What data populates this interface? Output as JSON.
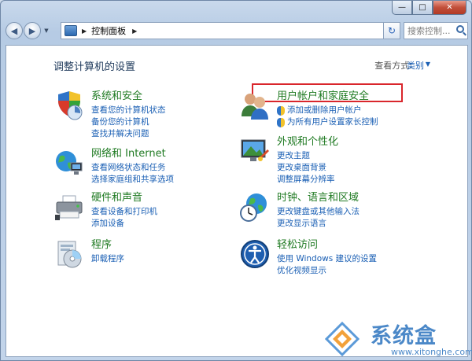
{
  "window": {
    "minimize_label": "—",
    "maximize_label": "□",
    "close_label": "✕"
  },
  "navbar": {
    "back_label": "◀",
    "forward_label": "▶",
    "history_dd": "▼",
    "breadcrumb_arrow": "▶",
    "breadcrumb": [
      "控制面板"
    ],
    "crumb_trailing_arrow": "▶",
    "address_dd": "▼",
    "refresh_label": "↻",
    "search_placeholder": "搜索控制..."
  },
  "page": {
    "title": "调整计算机的设置",
    "view_by_label": "查看方式:",
    "view_by_value": "类别",
    "view_by_dd": "▼"
  },
  "categories": [
    {
      "id": "system-security",
      "head": "系统和安全",
      "links": [
        "查看您的计算机状态",
        "备份您的计算机",
        "查找并解决问题"
      ]
    },
    {
      "id": "network-internet",
      "head": "网络和 Internet",
      "links": [
        "查看网络状态和任务",
        "选择家庭组和共享选项"
      ]
    },
    {
      "id": "hardware-sound",
      "head": "硬件和声音",
      "links": [
        "查看设备和打印机",
        "添加设备"
      ]
    },
    {
      "id": "programs",
      "head": "程序",
      "links": [
        "卸载程序"
      ]
    },
    {
      "id": "user-accounts",
      "head": "用户帐户和家庭安全",
      "links": [
        "添加或删除用户帐户",
        "为所有用户设置家长控制"
      ]
    },
    {
      "id": "appearance",
      "head": "外观和个性化",
      "links": [
        "更改主题",
        "更改桌面背景",
        "调整屏幕分辨率"
      ]
    },
    {
      "id": "clock-language",
      "head": "时钟、语言和区域",
      "links": [
        "更改键盘或其他输入法",
        "更改显示语言"
      ]
    },
    {
      "id": "ease-of-access",
      "head": "轻松访问",
      "links": [
        "使用 Windows 建议的设置",
        "优化视频显示"
      ]
    }
  ],
  "watermark": {
    "text": "系统盒",
    "url": "www.xitonghe.com"
  },
  "colors": {
    "heading_green": "#1f7a22",
    "link_blue": "#1a5fb4",
    "highlight_red": "#d9262c"
  }
}
